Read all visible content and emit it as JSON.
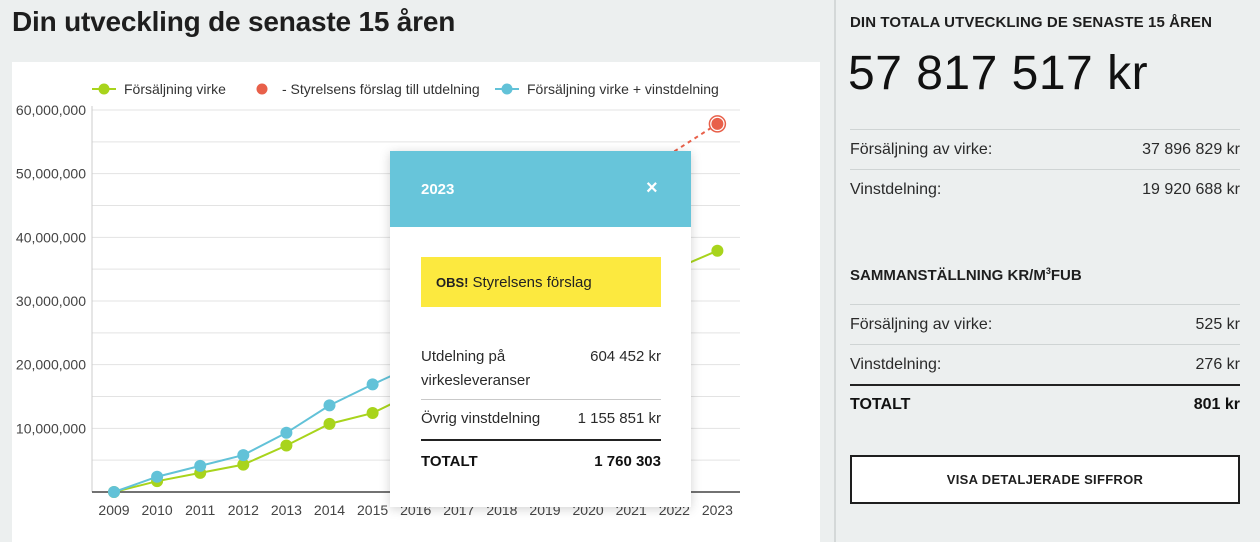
{
  "page": {
    "title": "Din utveckling de senaste 15 åren"
  },
  "legend": [
    {
      "label": "Försäljning virke",
      "color": "#a8d41c"
    },
    {
      "label": "- Styrelsens förslag till utdelning",
      "color": "#e8604a"
    },
    {
      "label": "Försäljning virke + vinstdelning",
      "color": "#62c2d8"
    }
  ],
  "chart_data": {
    "type": "line",
    "title": "",
    "xlabel": "",
    "ylabel": "",
    "x": [
      "2009",
      "2010",
      "2011",
      "2012",
      "2013",
      "2014",
      "2015",
      "2016",
      "2017",
      "2018",
      "2019",
      "2020",
      "2021",
      "2022",
      "2023"
    ],
    "ylim": [
      0,
      60000000
    ],
    "yticks": [
      "60,000,000",
      "50,000,000",
      "40,000,000",
      "30,000,000",
      "20,000,000",
      "10,000,000"
    ],
    "ytick_values": [
      60000000,
      50000000,
      40000000,
      30000000,
      20000000,
      10000000
    ],
    "series": [
      {
        "name": "Försäljning virke",
        "color": "#a8d41c",
        "values": [
          0,
          1700000,
          3000000,
          4300000,
          7300000,
          10700000,
          12400000,
          15700000,
          null,
          null,
          null,
          null,
          null,
          35000000,
          37896829
        ]
      },
      {
        "name": "Försäljning virke + vinstdelning",
        "color": "#62c2d8",
        "values": [
          0,
          2400000,
          4100000,
          5800000,
          9300000,
          13600000,
          16900000,
          20000000,
          null,
          null,
          null,
          null,
          null,
          null,
          null
        ]
      },
      {
        "name": "Styrelsens förslag till utdelning",
        "color": "#e8604a",
        "dashed": true,
        "values": [
          null,
          null,
          null,
          null,
          null,
          null,
          null,
          null,
          null,
          null,
          null,
          null,
          null,
          53500000,
          57817517
        ]
      }
    ],
    "grid": true,
    "legend_position": "top"
  },
  "popup": {
    "year": "2023",
    "close": "×",
    "obs_bold": "OBS!",
    "obs_text": "Styrelsens förslag",
    "row1_label": "Utdelning på virkesleveranser",
    "row1_value": "604 452 kr",
    "row2_label": "Övrig vinstdelning",
    "row2_value": "1 155 851 kr",
    "total_label": "TOTALT",
    "total_value": "1 760 303"
  },
  "summary": {
    "title": "DIN TOTALA UTVECKLING DE SENASTE 15 ÅREN",
    "total": "57 817 517 kr",
    "rows": [
      {
        "label": "Försäljning av virke:",
        "value": "37 896 829 kr"
      },
      {
        "label": "Vinstdelning:",
        "value": "19 920 688 kr"
      }
    ],
    "sub_title_pre": "SAMMANSTÄLLNING KR/M",
    "sub_title_sup": "3",
    "sub_title_post": "FUB",
    "per_m3": [
      {
        "label": "Försäljning av virke:",
        "value": "525 kr"
      },
      {
        "label": "Vinstdelning:",
        "value": "276 kr"
      }
    ],
    "per_m3_total": {
      "label": "TOTALT",
      "value": "801 kr"
    },
    "button": "VISA DETALJERADE SIFFROR"
  }
}
